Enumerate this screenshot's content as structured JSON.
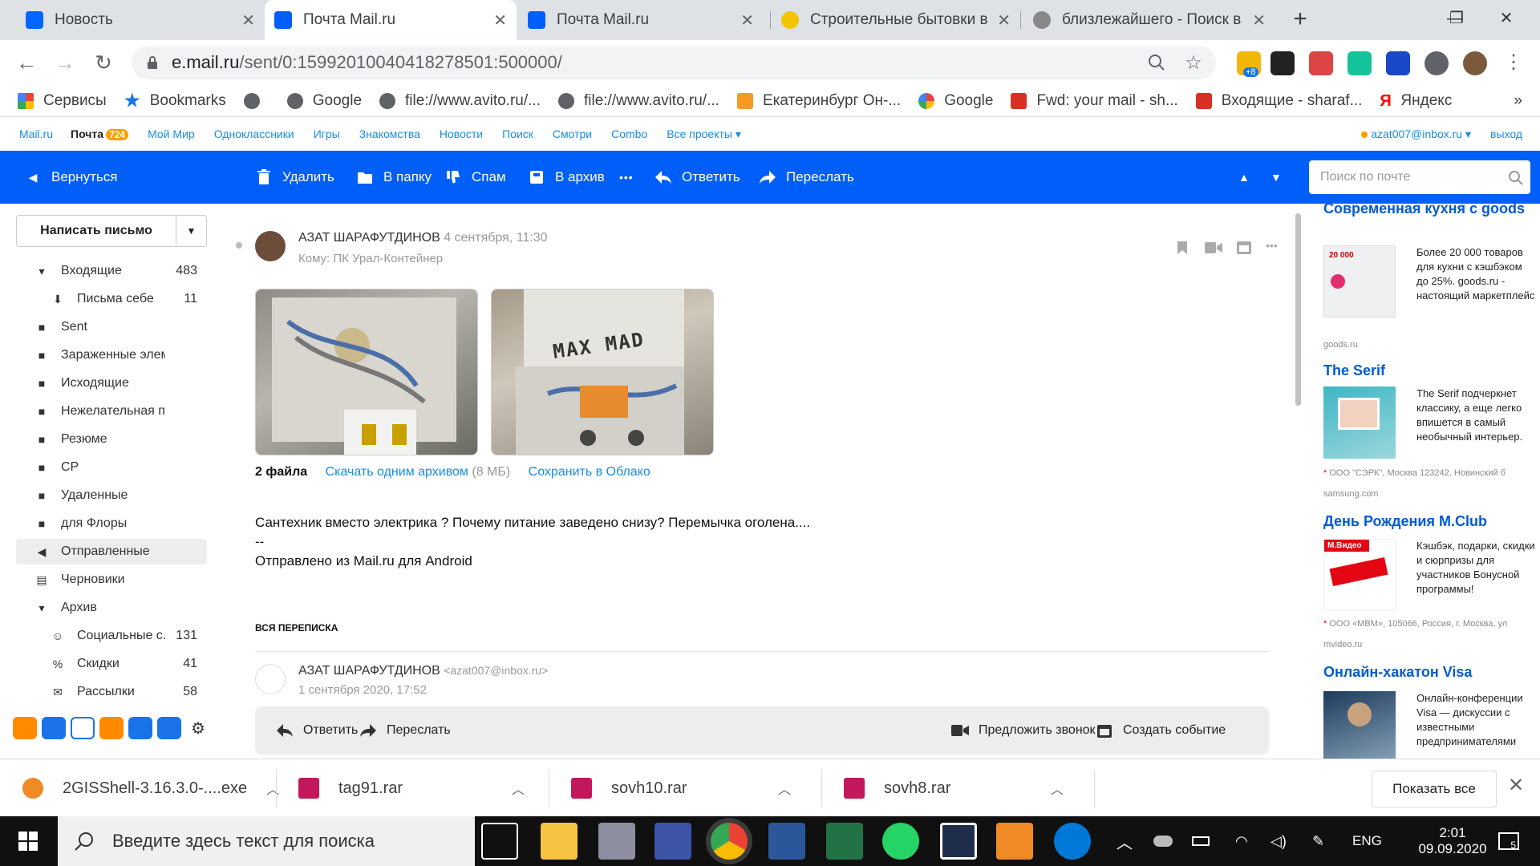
{
  "browser": {
    "tabs": [
      {
        "title": "Новость",
        "favicon_color": "#0066ff"
      },
      {
        "title": "Почта Mail.ru",
        "favicon_color": "#005ff9"
      },
      {
        "title": "Почта Mail.ru",
        "favicon_color": "#005ff9"
      },
      {
        "title": "Строительные бытовки в Е",
        "favicon_color": "#f5c400"
      },
      {
        "title": "близлежайшего - Поиск в",
        "favicon_color": "#888888"
      }
    ],
    "url_domain": "e.mail.ru",
    "url_path": "/sent/0:15992010040418278501:500000/",
    "extension_badge": "+8",
    "bookmarks": [
      {
        "label": "Сервисы",
        "icon": "apps-grid-icon"
      },
      {
        "label": "Bookmarks",
        "icon": "star-icon"
      },
      {
        "label": "",
        "icon": "globe-icon"
      },
      {
        "label": "Google",
        "icon": "globe-icon"
      },
      {
        "label": "file://www.avito.ru/...",
        "icon": "globe-icon"
      },
      {
        "label": "file://www.avito.ru/...",
        "icon": "globe-icon"
      },
      {
        "label": "Екатеринбург Он-...",
        "icon": "flame-icon"
      },
      {
        "label": "Google",
        "icon": "google-icon"
      },
      {
        "label": "Fwd: your mail - sh...",
        "icon": "gmail-icon"
      },
      {
        "label": "Входящие - sharaf...",
        "icon": "gmail-icon"
      },
      {
        "label": "Яндекс",
        "icon": "yandex-icon"
      }
    ]
  },
  "portal": {
    "links": [
      "Mail.ru",
      "Почта",
      "Мой Мир",
      "Одноклассники",
      "Игры",
      "Знакомства",
      "Новости",
      "Поиск",
      "Смотри",
      "Combo",
      "Все проекты"
    ],
    "mail_badge": "724",
    "user_email": "azat007@inbox.ru",
    "logout": "выход"
  },
  "toolbar": {
    "back": "Вернуться",
    "delete": "Удалить",
    "move": "В папку",
    "spam": "Спам",
    "archive": "В архив",
    "more": "•••",
    "reply": "Ответить",
    "forward": "Переслать",
    "search_placeholder": "Поиск по почте"
  },
  "sidebar": {
    "compose": "Написать письмо",
    "folders": [
      {
        "name": "Входящие",
        "count": "483",
        "icon": "chevron-down-icon"
      },
      {
        "name": "Письма себе",
        "count": "11",
        "icon": "self-mail-icon"
      },
      {
        "name": "Sent",
        "count": "",
        "icon": "folder-icon"
      },
      {
        "name": "Зараженные элементы",
        "count": "",
        "icon": "folder-icon"
      },
      {
        "name": "Исходящие",
        "count": "",
        "icon": "folder-icon"
      },
      {
        "name": "Нежелательная почта",
        "count": "",
        "icon": "folder-icon"
      },
      {
        "name": "Резюме",
        "count": "",
        "icon": "folder-icon"
      },
      {
        "name": "СР",
        "count": "",
        "icon": "folder-icon"
      },
      {
        "name": "Удаленные",
        "count": "",
        "icon": "folder-icon"
      },
      {
        "name": "для Флоры",
        "count": "",
        "icon": "folder-icon"
      },
      {
        "name": "Отправленные",
        "count": "",
        "icon": "sent-icon"
      },
      {
        "name": "Черновики",
        "count": "",
        "icon": "draft-icon"
      },
      {
        "name": "Архив",
        "count": "",
        "icon": "chevron-down-icon"
      },
      {
        "name": "Социальные с...",
        "count": "131",
        "icon": "social-icon"
      },
      {
        "name": "Скидки",
        "count": "41",
        "icon": "percent-icon"
      },
      {
        "name": "Рассылки",
        "count": "58",
        "icon": "newsletter-icon"
      }
    ]
  },
  "message": {
    "sender": "АЗАТ ШАРАФУТДИНОВ",
    "date": "4 сентября, 11:30",
    "to": "Кому: ПК Урал-Контейнер",
    "files_count": "2 файла",
    "download_archive": "Скачать одним архивом",
    "archive_size": "(8 МБ)",
    "save_cloud": "Сохранить в Облако",
    "photo_label": "MAX MAD",
    "body_line1": "Сантехник вместо электрика ? Почему питание заведено снизу? Перемычка оголена....",
    "body_line2": "--",
    "body_line3": "Отправлено из Mail.ru для Android",
    "thread_title": "ВСЯ ПЕРЕПИСКА",
    "thread_sender": "АЗАТ ШАРАФУТДИНОВ",
    "thread_email": "<azat007@inbox.ru>",
    "thread_date": "1 сентября 2020, 17:52",
    "reply": "Ответить",
    "forward": "Переслать",
    "suggest_call": "Предложить звонок",
    "create_event": "Создать событие"
  },
  "ads": [
    {
      "title": "Современная кухня с goods",
      "text": "Более 20 000 товаров для кухни с кэшбэком до 25%. goods.ru - настоящий маркетплейс",
      "source": "goods.ru",
      "legal": "",
      "img_label": "20 000"
    },
    {
      "title": "The Serif",
      "text": "The Serif подчеркнет классику, а еще легко впишется в самый необычный интерьер.",
      "source": "samsung.com",
      "legal": "ООО \"СЭРК\", Москва 123242, Новинский б",
      "img_label": ""
    },
    {
      "title": "День Рождения M.Club",
      "text": "Кэшбэк, подарки, скидки и сюрпризы для участников Бонусной программы!",
      "source": "mvideo.ru",
      "legal": "ООО «МВМ», 105066, Россия, г. Москва, ул",
      "img_label": "М.Видео"
    },
    {
      "title": "Онлайн-хакатон Visa",
      "text": "Онлайн-конференции Visa — дискуссии с известными предпринимателями",
      "source": "",
      "legal": "",
      "img_label": ""
    }
  ],
  "downloads": [
    {
      "name": "2GISShell-3.16.3.0-....exe"
    },
    {
      "name": "tag91.rar"
    },
    {
      "name": "sovh10.rar"
    },
    {
      "name": "sovh8.rar"
    }
  ],
  "downloads_show_all": "Показать все",
  "taskbar": {
    "search_placeholder": "Введите здесь текст для поиска",
    "lang": "ENG",
    "time": "2:01",
    "date": "09.09.2020",
    "notifications": "5"
  }
}
